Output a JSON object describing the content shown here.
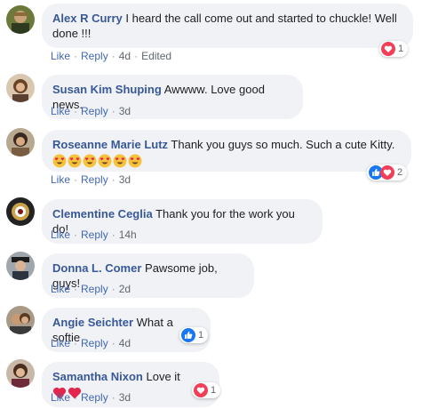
{
  "comments": [
    {
      "author": "Alex R Curry",
      "text": "I heard the call come out and started to chuckle! Well done !!!",
      "like": "Like",
      "reply": "Reply",
      "time": "4d",
      "edited": "Edited",
      "reaction_icon": "love-icon",
      "reaction_count": "1"
    },
    {
      "author": "Susan Kim Shuping",
      "text": "Awwww. Love good news.",
      "like": "Like",
      "reply": "Reply",
      "time": "3d"
    },
    {
      "author": "Roseanne Marie Lutz",
      "text": "Thank you guys so much. Such a cute Kitty.",
      "emoji": "heart-eyes-emoji x6",
      "like": "Like",
      "reply": "Reply",
      "time": "3d",
      "reaction_icon": "like-and-love-icons",
      "reaction_count": "2"
    },
    {
      "author": "Clementine Ceglia",
      "text": "Thank you for the work you do!",
      "like": "Like",
      "reply": "Reply",
      "time": "14h"
    },
    {
      "author": "Donna L. Comer",
      "text": "Pawsome job, guys!",
      "like": "Like",
      "reply": "Reply",
      "time": "2d"
    },
    {
      "author": "Angie Seichter",
      "text": "What a softie",
      "like": "Like",
      "reply": "Reply",
      "time": "4d",
      "reaction_icon": "like-icon",
      "reaction_count": "1"
    },
    {
      "author": "Samantha Nixon",
      "text": "Love it",
      "emoji": "red-heart-emoji x2",
      "like": "Like",
      "reply": "Reply",
      "time": "3d",
      "reaction_icon": "love-icon",
      "reaction_count": "1"
    }
  ],
  "colors": {
    "author": "#385898",
    "link": "#4267b2",
    "bubble": "#f0f2f5",
    "love": "#f33e58",
    "like": "#1877f2"
  }
}
